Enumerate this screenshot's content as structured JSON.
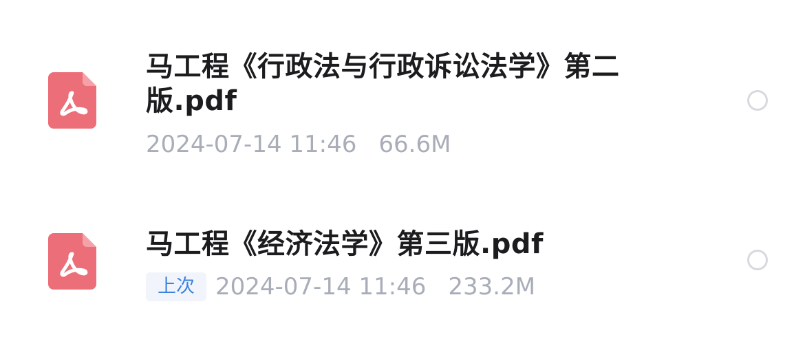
{
  "files": [
    {
      "icon": "pdf-file-icon",
      "name": "马工程《行政法与行政诉讼法学》第二版.pdf",
      "date": "2024-07-14 11:46",
      "size": "66.6M",
      "selected": false
    },
    {
      "icon": "pdf-file-icon",
      "badge": "上次",
      "name": "马工程《经济法学》第三版.pdf",
      "date": "2024-07-14 11:46",
      "size": "233.2M",
      "selected": false
    }
  ],
  "colors": {
    "pdf_icon": "#ec6e78",
    "badge_text": "#3d82dd",
    "badge_bg": "#f1f5fb",
    "meta_text": "#a9adb8",
    "title_text": "#1c1c1e"
  }
}
